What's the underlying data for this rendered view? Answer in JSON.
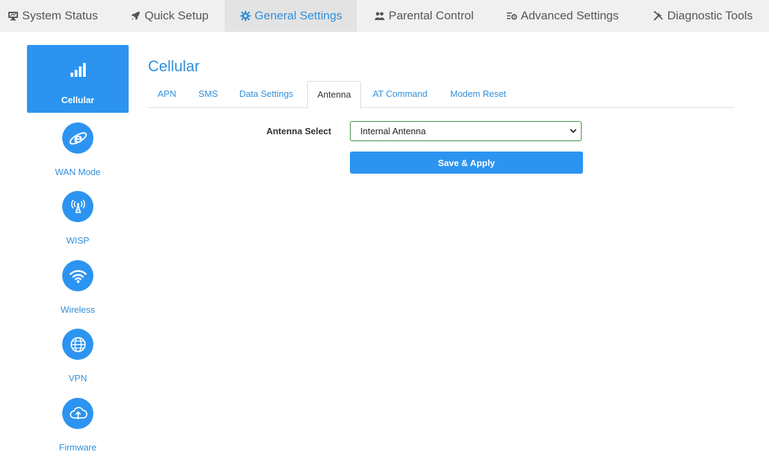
{
  "topnav": {
    "tabs": [
      {
        "label": "System Status",
        "icon": "monitor-icon"
      },
      {
        "label": "Quick Setup",
        "icon": "rocket-icon"
      },
      {
        "label": "General Settings",
        "icon": "gear-icon",
        "active": true
      },
      {
        "label": "Parental Control",
        "icon": "users-icon"
      },
      {
        "label": "Advanced Settings",
        "icon": "list-gear-icon"
      },
      {
        "label": "Diagnostic Tools",
        "icon": "tools-icon"
      }
    ]
  },
  "sidebar": {
    "items": [
      {
        "label": "Cellular",
        "icon": "signal-bars-icon",
        "active": true
      },
      {
        "label": "WAN Mode",
        "icon": "internet-e-icon"
      },
      {
        "label": "WISP",
        "icon": "antenna-tower-icon"
      },
      {
        "label": "Wireless",
        "icon": "wifi-icon"
      },
      {
        "label": "VPN",
        "icon": "globe-icon"
      },
      {
        "label": "Firmware",
        "icon": "cloud-upload-icon"
      }
    ]
  },
  "main": {
    "title": "Cellular",
    "subtabs": [
      {
        "label": "APN"
      },
      {
        "label": "SMS"
      },
      {
        "label": "Data Settings"
      },
      {
        "label": "Antenna",
        "active": true
      },
      {
        "label": "AT Command"
      },
      {
        "label": "Modem Reset"
      }
    ],
    "form": {
      "antenna_label": "Antenna Select",
      "antenna_value": "Internal Antenna",
      "save_label": "Save & Apply"
    }
  },
  "colors": {
    "accent": "#2c94f0",
    "link": "#2f8fdc",
    "select_border": "#3c8c3c",
    "nav_bg": "#f0f0f0"
  }
}
